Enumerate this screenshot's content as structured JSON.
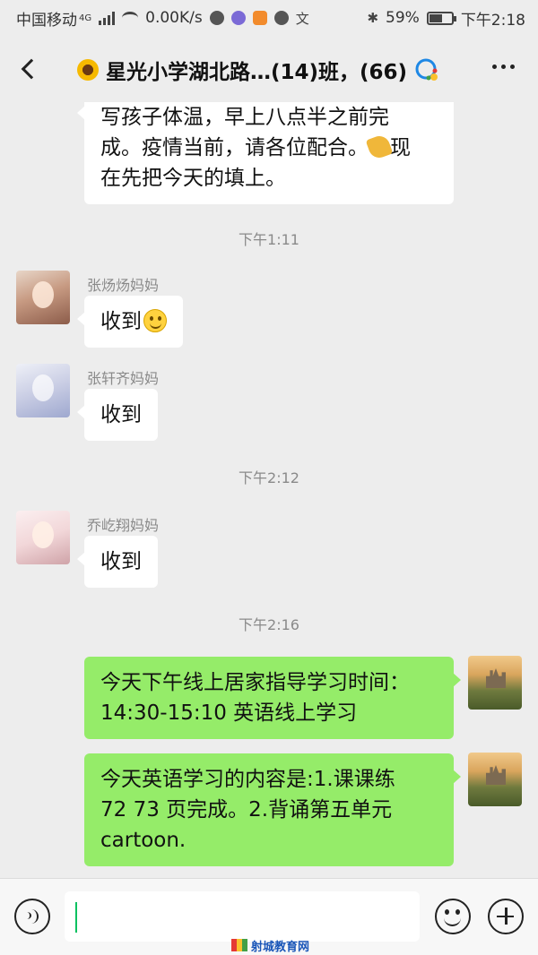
{
  "status_bar": {
    "carrier": "中国移动",
    "network": "4G",
    "speed": "0.00K/s",
    "battery": "59%",
    "battery_level": 0.59,
    "time": "下午2:18"
  },
  "header": {
    "title": "星光小学湖北路…(14)班，(66)"
  },
  "messages": [
    {
      "type": "text",
      "direction": "in",
      "text": "写孩子体温，早上八点半之前完成。疫情当前，请各位配合。现在先把今天的填上。"
    },
    {
      "type": "time",
      "text": "下午1:11"
    },
    {
      "type": "text",
      "direction": "in",
      "sender": "张炀炀妈妈",
      "text": "收到"
    },
    {
      "type": "text",
      "direction": "in",
      "sender": "张轩齐妈妈",
      "text": "收到"
    },
    {
      "type": "time",
      "text": "下午2:12"
    },
    {
      "type": "text",
      "direction": "in",
      "sender": "乔屹翔妈妈",
      "text": "收到"
    },
    {
      "type": "time",
      "text": "下午2:16"
    },
    {
      "type": "text",
      "direction": "out",
      "text": "今天下午线上居家指导学习时间：14:30-15:10 英语线上学习"
    },
    {
      "type": "text",
      "direction": "out",
      "text": "今天英语学习的内容是:1.课课练72  73页完成。2.背诵第五单元cartoon."
    }
  ],
  "message_lines": {
    "m0": [
      "写孩子体温，早上八点半之前完",
      "成。疫情当前，请各位配合。",
      "在先把今天的填上。"
    ],
    "m0_suffix": "现",
    "m7": [
      "今天下午线上居家指导学习时间：",
      "14:30-15:10 英语线上学习"
    ],
    "m8": [
      "今天英语学习的内容是:1.课课练",
      "72  73 页完成。2.背诵第五单元",
      "cartoon."
    ]
  },
  "watermark": "射城教育网",
  "colors": {
    "background": "#ededed",
    "incoming_bubble": "#ffffff",
    "outgoing_bubble": "#95ec69",
    "meta_text": "#8a8a8a",
    "caret": "#07c160"
  }
}
